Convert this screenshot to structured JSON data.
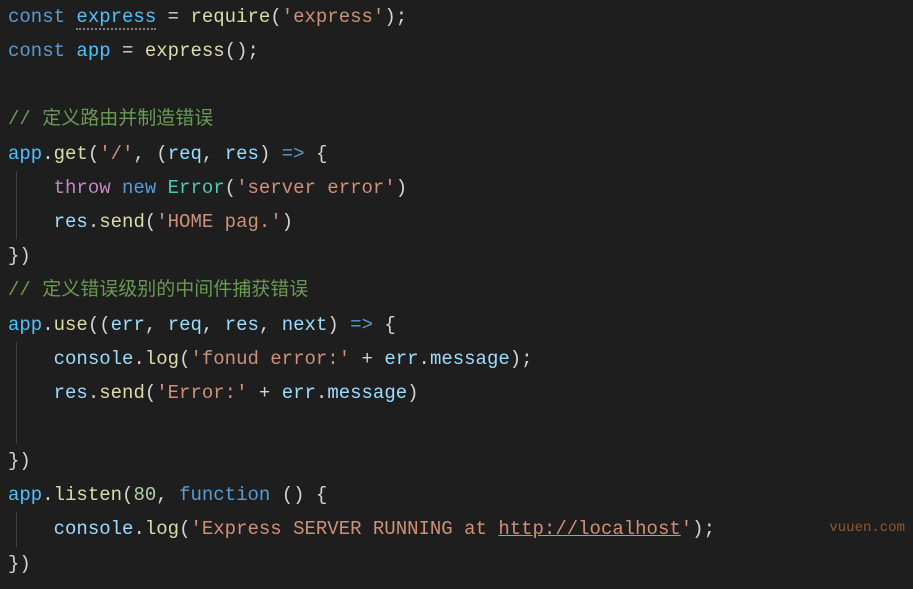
{
  "watermark": "vuuen.com",
  "code": {
    "l1": {
      "t1": "const",
      "t2": "express",
      "t3": "=",
      "t4": "require",
      "t5": "(",
      "t6": "'express'",
      "t7": ");"
    },
    "l2": {
      "t1": "const",
      "t2": "app",
      "t3": "=",
      "t4": "express",
      "t5": "();"
    },
    "l4": {
      "t1": "// 定义路由并制造错误"
    },
    "l5": {
      "t1": "app",
      "t2": ".",
      "t3": "get",
      "t4": "(",
      "t5": "'/'",
      "t6": ",",
      "t7": "(",
      "t8": "req",
      "t9": ",",
      "t10": "res",
      "t11": ")",
      "t12": "=>",
      "t13": "{"
    },
    "l6": {
      "t1": "throw",
      "t2": "new",
      "t3": "Error",
      "t4": "(",
      "t5": "'server error'",
      "t6": ")"
    },
    "l7": {
      "t1": "res",
      "t2": ".",
      "t3": "send",
      "t4": "(",
      "t5": "'HOME pag.'",
      "t6": ")"
    },
    "l8": {
      "t1": "})"
    },
    "l9": {
      "t1": "// 定义错误级别的中间件捕获错误"
    },
    "l10": {
      "t1": "app",
      "t2": ".",
      "t3": "use",
      "t4": "((",
      "t5": "err",
      "t6": ",",
      "t7": "req",
      "t8": ",",
      "t9": "res",
      "t10": ",",
      "t11": "next",
      "t12": ")",
      "t13": "=>",
      "t14": "{"
    },
    "l11": {
      "t1": "console",
      "t2": ".",
      "t3": "log",
      "t4": "(",
      "t5": "'fonud error:'",
      "t6": "+",
      "t7": "err",
      "t8": ".",
      "t9": "message",
      "t10": ");"
    },
    "l12": {
      "t1": "res",
      "t2": ".",
      "t3": "send",
      "t4": "(",
      "t5": "'Error:'",
      "t6": "+",
      "t7": "err",
      "t8": ".",
      "t9": "message",
      "t10": ")"
    },
    "l14": {
      "t1": "})"
    },
    "l15": {
      "t1": "app",
      "t2": ".",
      "t3": "listen",
      "t4": "(",
      "t5": "80",
      "t6": ",",
      "t7": "function",
      "t8": "()",
      "t9": "{"
    },
    "l16": {
      "t1": "console",
      "t2": ".",
      "t3": "log",
      "t4": "(",
      "t5": "'Express SERVER RUNNING at ",
      "t6": "http://localhost",
      "t7": "'",
      "t8": ");"
    },
    "l17": {
      "t1": "})"
    }
  }
}
